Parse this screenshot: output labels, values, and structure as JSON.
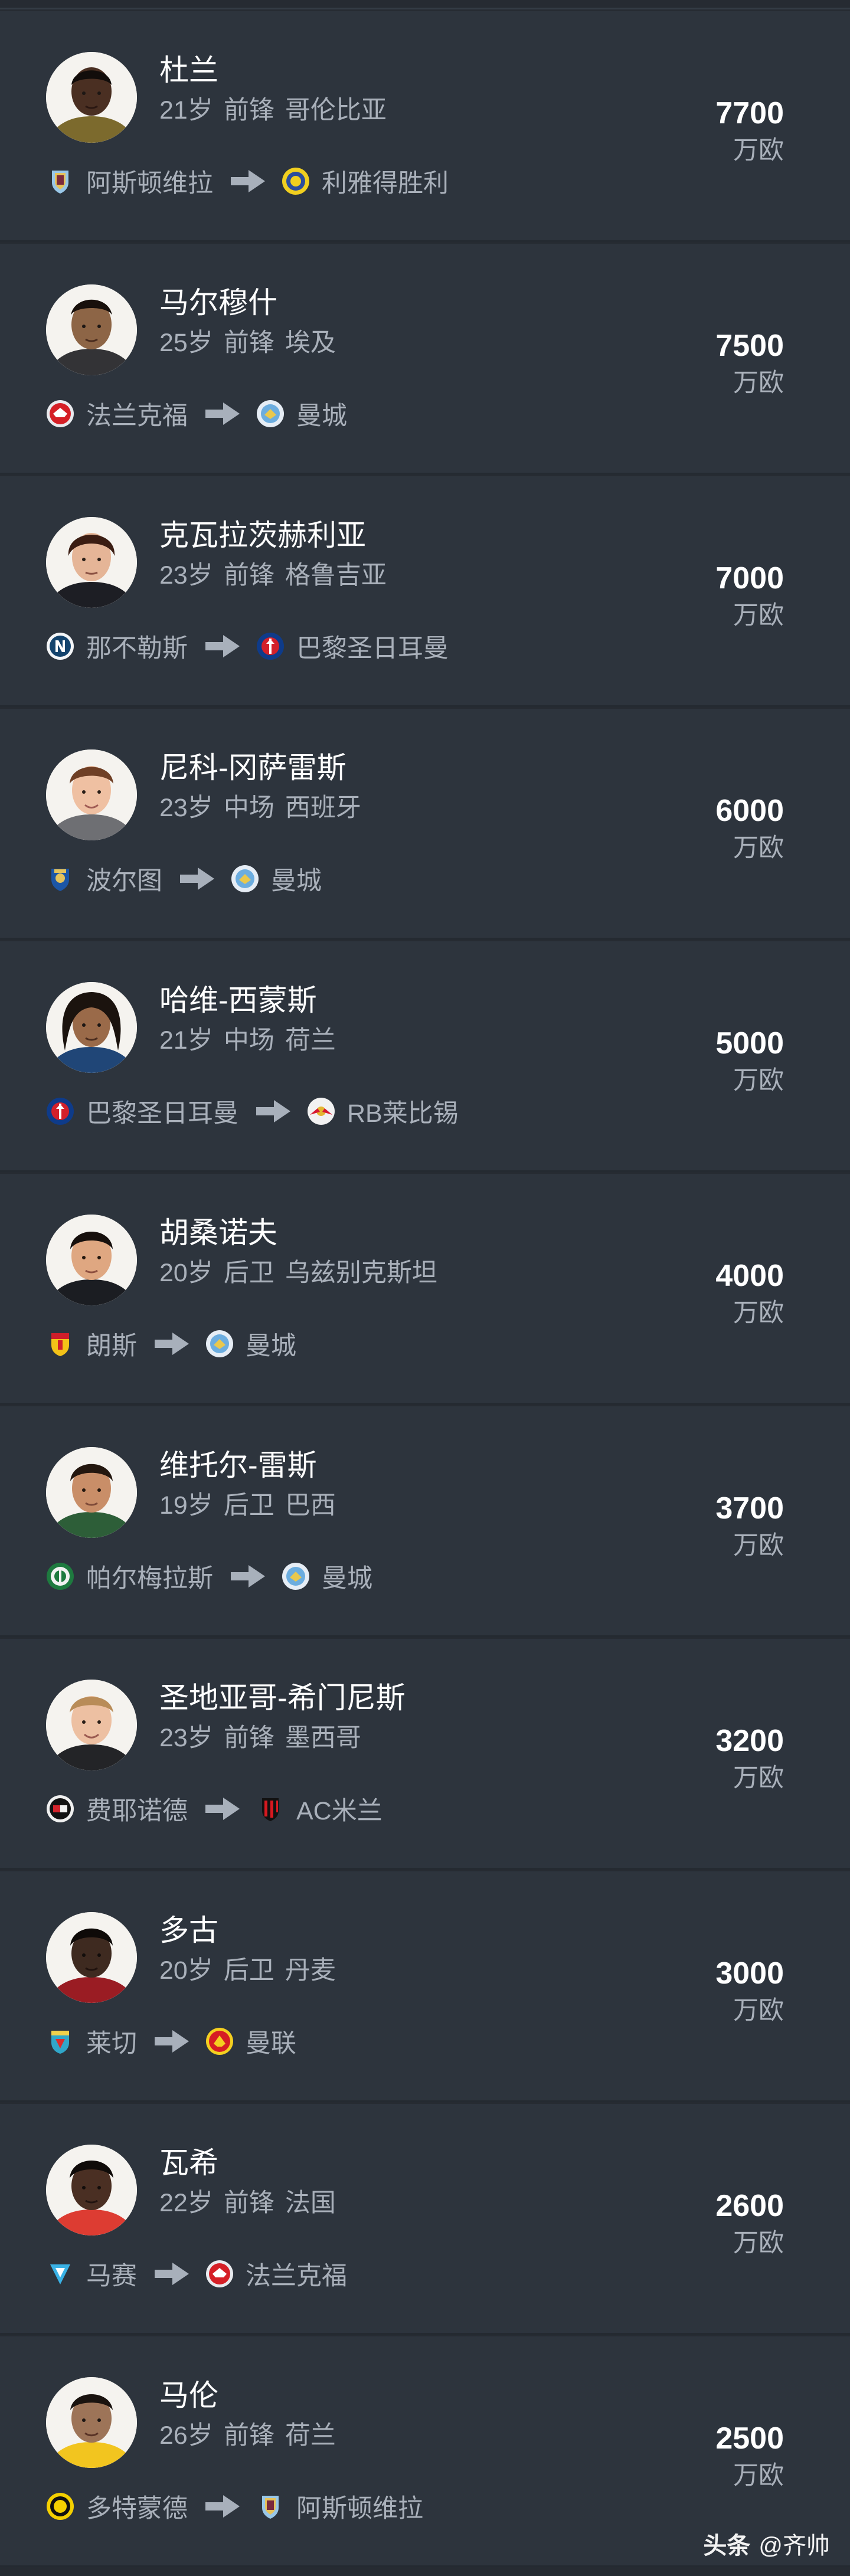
{
  "unit_label": "万欧",
  "players": [
    {
      "name": "杜兰",
      "age": "21岁",
      "position": "前锋",
      "nationality": "哥伦比亚",
      "from_club": "阿斯顿维拉",
      "to_club": "利雅得胜利",
      "fee": "7700",
      "from_badge": "aston-villa-badge-icon",
      "to_badge": "al-nassr-badge-icon"
    },
    {
      "name": "马尔穆什",
      "age": "25岁",
      "position": "前锋",
      "nationality": "埃及",
      "from_club": "法兰克福",
      "to_club": "曼城",
      "fee": "7500",
      "from_badge": "frankfurt-badge-icon",
      "to_badge": "man-city-badge-icon"
    },
    {
      "name": "克瓦拉茨赫利亚",
      "age": "23岁",
      "position": "前锋",
      "nationality": "格鲁吉亚",
      "from_club": "那不勒斯",
      "to_club": "巴黎圣日耳曼",
      "fee": "7000",
      "from_badge": "napoli-badge-icon",
      "to_badge": "psg-badge-icon"
    },
    {
      "name": "尼科-冈萨雷斯",
      "age": "23岁",
      "position": "中场",
      "nationality": "西班牙",
      "from_club": "波尔图",
      "to_club": "曼城",
      "fee": "6000",
      "from_badge": "porto-badge-icon",
      "to_badge": "man-city-badge-icon"
    },
    {
      "name": "哈维-西蒙斯",
      "age": "21岁",
      "position": "中场",
      "nationality": "荷兰",
      "from_club": "巴黎圣日耳曼",
      "to_club": "RB莱比锡",
      "fee": "5000",
      "from_badge": "psg-badge-icon",
      "to_badge": "rb-leipzig-badge-icon"
    },
    {
      "name": "胡桑诺夫",
      "age": "20岁",
      "position": "后卫",
      "nationality": "乌兹别克斯坦",
      "from_club": "朗斯",
      "to_club": "曼城",
      "fee": "4000",
      "from_badge": "lens-badge-icon",
      "to_badge": "man-city-badge-icon"
    },
    {
      "name": "维托尔-雷斯",
      "age": "19岁",
      "position": "后卫",
      "nationality": "巴西",
      "from_club": "帕尔梅拉斯",
      "to_club": "曼城",
      "fee": "3700",
      "from_badge": "palmeiras-badge-icon",
      "to_badge": "man-city-badge-icon"
    },
    {
      "name": "圣地亚哥-希门尼斯",
      "age": "23岁",
      "position": "前锋",
      "nationality": "墨西哥",
      "from_club": "费耶诺德",
      "to_club": "AC米兰",
      "fee": "3200",
      "from_badge": "feyenoord-badge-icon",
      "to_badge": "ac-milan-badge-icon"
    },
    {
      "name": "多古",
      "age": "20岁",
      "position": "后卫",
      "nationality": "丹麦",
      "from_club": "莱切",
      "to_club": "曼联",
      "fee": "3000",
      "from_badge": "lecce-badge-icon",
      "to_badge": "man-utd-badge-icon"
    },
    {
      "name": "瓦希",
      "age": "22岁",
      "position": "前锋",
      "nationality": "法国",
      "from_club": "马赛",
      "to_club": "法兰克福",
      "fee": "2600",
      "from_badge": "marseille-badge-icon",
      "to_badge": "frankfurt-badge-icon"
    },
    {
      "name": "马伦",
      "age": "26岁",
      "position": "前锋",
      "nationality": "荷兰",
      "from_club": "多特蒙德",
      "to_club": "阿斯顿维拉",
      "fee": "2500",
      "from_badge": "dortmund-badge-icon",
      "to_badge": "aston-villa-badge-icon"
    }
  ],
  "watermark": {
    "brand": "头条",
    "handle": "@齐帅"
  }
}
